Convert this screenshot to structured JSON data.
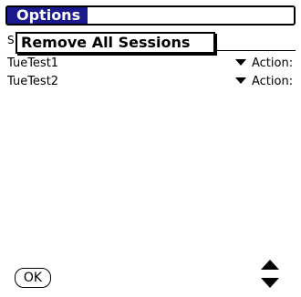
{
  "menu": {
    "title": "Options",
    "items": [
      "Remove All Sessions"
    ]
  },
  "stub_text": "S",
  "sessions": [
    {
      "name": "TueTest1",
      "action_label": "Action:"
    },
    {
      "name": "TueTest2",
      "action_label": "Action:"
    }
  ],
  "buttons": {
    "ok_label": "OK"
  }
}
